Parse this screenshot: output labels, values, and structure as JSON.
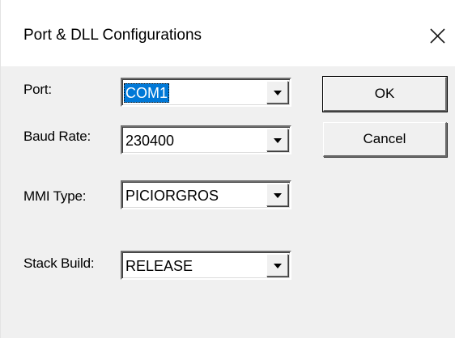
{
  "window": {
    "title": "Port & DLL Configurations",
    "close_glyph": "✕"
  },
  "fields": {
    "port": {
      "label": "Port:",
      "value": "COM1"
    },
    "baud_rate": {
      "label": "Baud Rate:",
      "value": "230400"
    },
    "mmi_type": {
      "label": "MMI Type:",
      "value": "PICIORGROS"
    },
    "stack_build": {
      "label": "Stack Build:",
      "value": "RELEASE"
    }
  },
  "buttons": {
    "ok": "OK",
    "cancel": "Cancel"
  },
  "icons": {
    "close": "close-icon",
    "dropdown": "chevron-down-icon"
  },
  "colors": {
    "selection": "#0078d7",
    "background": "#f0f0f0",
    "titlebar": "#ffffff"
  }
}
